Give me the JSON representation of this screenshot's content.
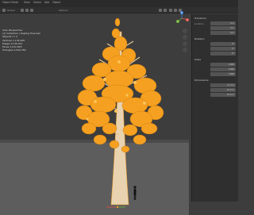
{
  "header": {
    "menus": [
      {
        "label": "Object Mode"
      },
      {
        "label": "View"
      },
      {
        "label": "Select"
      },
      {
        "label": "Add"
      },
      {
        "label": "Object"
      }
    ]
  },
  "toolbar": {
    "items": [
      {
        "label": "Global"
      },
      {
        "label": "Options"
      }
    ]
  },
  "viewport": {
    "stats": {
      "line1": "User Perspective",
      "line2": "(1) Collection | Sapling Tree Gen",
      "line3": "Objects  1 / 2",
      "line4": "Vertices  1,134,945",
      "line5": "Edges  2,145,321",
      "line6": "Faces  1,011,823",
      "line7": "Triangles  2,042,760"
    }
  },
  "panel": {
    "sections": [
      {
        "title": "Transform",
        "rows": [
          {
            "label": "Location",
            "value": "0 m"
          },
          {
            "label": "",
            "value": "0 m"
          },
          {
            "label": "",
            "value": "0 m"
          }
        ]
      },
      {
        "title": "Rotation",
        "rows": [
          {
            "label": "",
            "value": "0°"
          },
          {
            "label": "",
            "value": "0°"
          },
          {
            "label": "",
            "value": "0°"
          }
        ]
      },
      {
        "title": "Scale",
        "rows": [
          {
            "label": "",
            "value": "1.000"
          },
          {
            "label": "",
            "value": "1.000"
          },
          {
            "label": "",
            "value": "1.000"
          }
        ]
      },
      {
        "title": "Dimensions",
        "rows": [
          {
            "label": "",
            "value": "11.4 m"
          },
          {
            "label": "",
            "value": "10.3 m"
          },
          {
            "label": "",
            "value": "21.6 m"
          }
        ]
      }
    ]
  },
  "gizmo": {
    "x_label": "X",
    "y_label": "Y",
    "z_label": "Z",
    "x_color": "#e2504c",
    "y_color": "#74b43c",
    "z_color": "#3e82e0"
  },
  "colors": {
    "selection": "#f5a020",
    "viewport_bg": "#3d3d3d",
    "ground": "#5e5e5e"
  }
}
